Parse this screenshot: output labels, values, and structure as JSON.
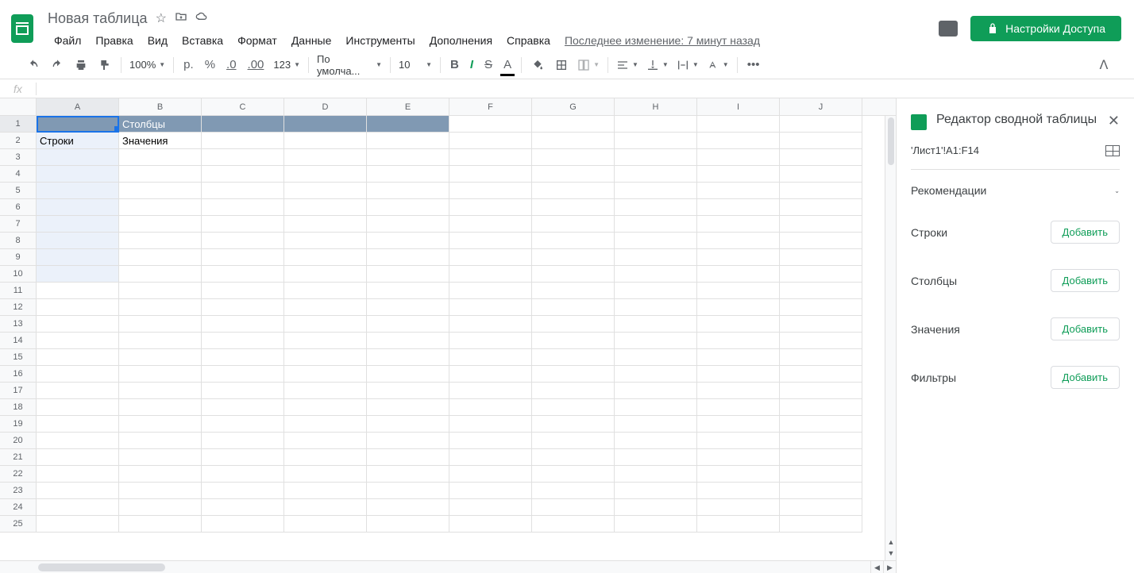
{
  "header": {
    "title": "Новая таблица",
    "menus": [
      "Файл",
      "Правка",
      "Вид",
      "Вставка",
      "Формат",
      "Данные",
      "Инструменты",
      "Дополнения",
      "Справка"
    ],
    "last_edit": "Последнее изменение: 7 минут назад",
    "share_label": "Настройки Доступа"
  },
  "toolbar": {
    "zoom": "100%",
    "currency": "р.",
    "percent": "%",
    "dec_less": ".0",
    "dec_more": ".00",
    "fmt123": "123",
    "font": "По умолча...",
    "font_size": "10",
    "more": "•••"
  },
  "grid": {
    "columns": [
      "A",
      "B",
      "C",
      "D",
      "E",
      "F",
      "G",
      "H",
      "I",
      "J"
    ],
    "rows": 25,
    "cells": {
      "B1": "Столбцы",
      "A2": "Строки",
      "B2": "Значения"
    }
  },
  "panel": {
    "title": "Редактор сводной таблицы",
    "range": "'Лист1'!A1:F14",
    "recommendations": "Рекомендации",
    "sections": [
      {
        "label": "Строки",
        "button": "Добавить"
      },
      {
        "label": "Столбцы",
        "button": "Добавить"
      },
      {
        "label": "Значения",
        "button": "Добавить"
      },
      {
        "label": "Фильтры",
        "button": "Добавить"
      }
    ]
  }
}
